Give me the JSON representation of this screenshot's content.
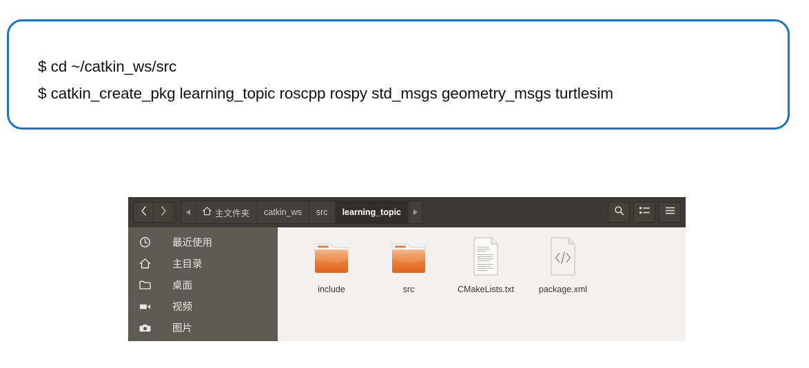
{
  "terminal_callout": {
    "border_color": "#1777c0",
    "lines": [
      "$ cd ~/catkin_ws/src",
      "$ catkin_create_pkg learning_topic roscpp rospy std_msgs geometry_msgs turtlesim"
    ]
  },
  "file_manager": {
    "toolbar": {
      "back_icon": "chevron-left-icon",
      "forward_icon": "chevron-right-icon",
      "search_icon": "search-icon",
      "view_toggle_icon": "list-view-icon",
      "menu_icon": "hamburger-menu-icon",
      "prev_crumb_arrow": "triangle-left-icon",
      "next_crumb_arrow": "triangle-right-icon"
    },
    "breadcrumb": [
      {
        "label": "主文件夹",
        "icon": "home-icon",
        "current": false
      },
      {
        "label": "catkin_ws",
        "icon": "",
        "current": false
      },
      {
        "label": "src",
        "icon": "",
        "current": false
      },
      {
        "label": "learning_topic",
        "icon": "",
        "current": true
      }
    ],
    "sidebar": {
      "background": "#5c5b51",
      "items": [
        {
          "label": "最近使用",
          "icon": "clock-icon"
        },
        {
          "label": "主目录",
          "icon": "home-icon"
        },
        {
          "label": "桌面",
          "icon": "folder-icon"
        },
        {
          "label": "视频",
          "icon": "video-icon"
        },
        {
          "label": "图片",
          "icon": "camera-icon"
        }
      ]
    },
    "files": [
      {
        "name": "include",
        "type": "folder"
      },
      {
        "name": "src",
        "type": "folder"
      },
      {
        "name": "CMakeLists.txt",
        "type": "text-file"
      },
      {
        "name": "package.xml",
        "type": "xml-file"
      }
    ],
    "colors": {
      "toolbar": "#3b3a35",
      "content": "#f2f1f0",
      "folder": "#e8713a"
    }
  }
}
